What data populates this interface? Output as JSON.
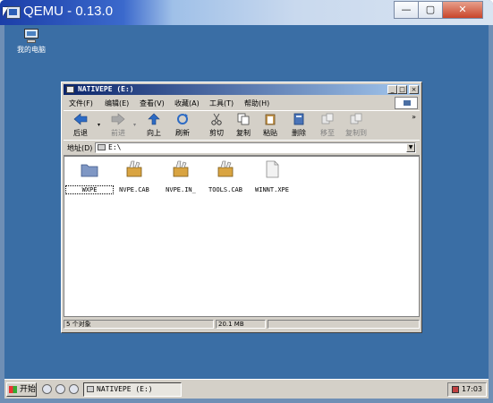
{
  "host_window": {
    "title": "QEMU - 0.13.0",
    "controls": {
      "minimize": "—",
      "maximize": "▢",
      "close": "✕"
    }
  },
  "desktop": {
    "icons": [
      {
        "label": "我的电脑",
        "icon": "my-computer-icon"
      }
    ]
  },
  "explorer": {
    "title": "NATIVEPE (E:)",
    "menu": [
      "文件(F)",
      "编辑(E)",
      "查看(V)",
      "收藏(A)",
      "工具(T)",
      "帮助(H)"
    ],
    "toolbar": {
      "back": "后退",
      "forward": "前进",
      "up": "向上",
      "refresh": "刷新",
      "cut": "剪切",
      "copy": "复制",
      "paste": "粘贴",
      "delete": "删除",
      "move_to": "移至",
      "copy_to": "复制到"
    },
    "address": {
      "label": "地址(D)",
      "value": "E:\\"
    },
    "files": [
      {
        "name": "WXPE",
        "type": "folder"
      },
      {
        "name": "NVPE.CAB",
        "type": "cab"
      },
      {
        "name": "NVPE.IN_",
        "type": "cab"
      },
      {
        "name": "TOOLS.CAB",
        "type": "cab"
      },
      {
        "name": "WINNT.XPE",
        "type": "file"
      }
    ],
    "status": {
      "objects": "5 个对象",
      "size": "20.1 MB"
    }
  },
  "taskbar": {
    "start": "开始",
    "task": "NATIVEPE (E:)",
    "clock": "17:03"
  },
  "colors": {
    "desktop": "#3a6ea5",
    "title_active": "#0a246a",
    "face": "#d4d0c8"
  }
}
